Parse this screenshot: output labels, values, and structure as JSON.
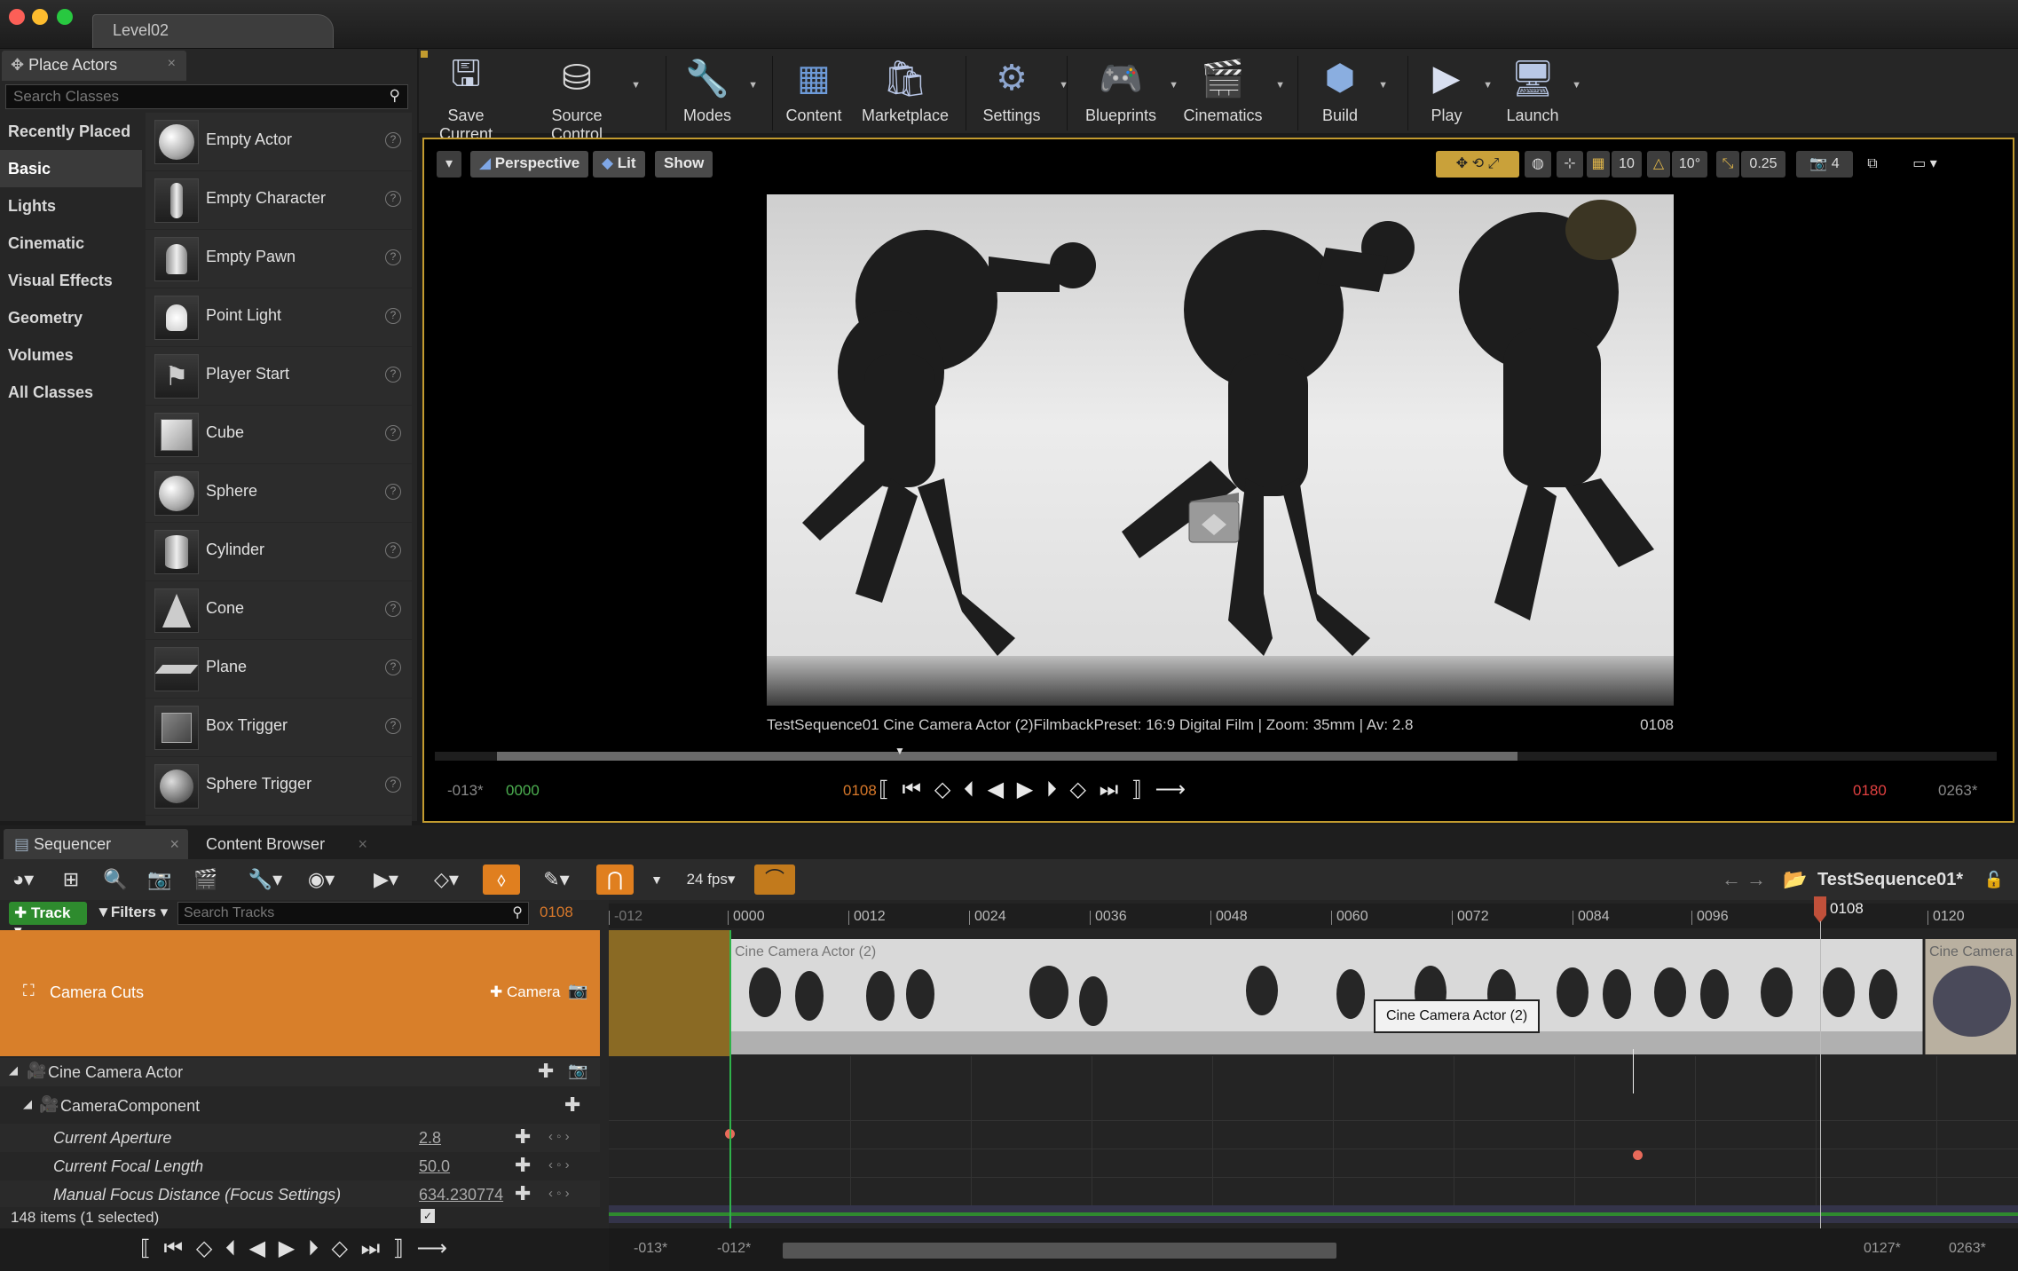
{
  "window": {
    "tab": "Level02"
  },
  "place_actors": {
    "tab_label": "Place Actors",
    "search_placeholder": "Search Classes",
    "categories": [
      "Recently Placed",
      "Basic",
      "Lights",
      "Cinematic",
      "Visual Effects",
      "Geometry",
      "Volumes",
      "All Classes"
    ],
    "active_category": "Basic",
    "items": [
      "Empty Actor",
      "Empty Character",
      "Empty Pawn",
      "Point Light",
      "Player Start",
      "Cube",
      "Sphere",
      "Cylinder",
      "Cone",
      "Plane",
      "Box Trigger",
      "Sphere Trigger"
    ]
  },
  "toolbar": {
    "save": "Save Current",
    "source": "Source Control",
    "modes": "Modes",
    "content": "Content",
    "marketplace": "Marketplace",
    "settings": "Settings",
    "blueprints": "Blueprints",
    "cinematics": "Cinematics",
    "build": "Build",
    "play": "Play",
    "launch": "Launch"
  },
  "viewport": {
    "perspective": "Perspective",
    "lit": "Lit",
    "show": "Show",
    "grid": "10",
    "angle": "10°",
    "scale": "0.25",
    "speed": "4",
    "caption": "TestSequence01  Cine Camera Actor (2)FilmbackPreset: 16:9 Digital Film | Zoom: 35mm | Av: 2.8",
    "frame": "0108",
    "start_out": "-013*",
    "start_in": "0000",
    "current": "0108",
    "end_in": "0180",
    "end_out": "0263*"
  },
  "bottom_tabs": {
    "sequencer": "Sequencer",
    "content_browser": "Content Browser"
  },
  "sequencer": {
    "fps": "24 fps",
    "sequence_name": "TestSequence01*",
    "track_btn": "Track",
    "filters": "Filters",
    "search_placeholder": "Search Tracks",
    "current_frame": "0108",
    "playhead_label": "0108",
    "ruler": [
      "-012",
      "0000",
      "0012",
      "0024",
      "0036",
      "0048",
      "0060",
      "0072",
      "0084",
      "0096",
      "0108",
      "0120"
    ],
    "camera_cuts": "Camera Cuts",
    "add_camera": "Camera",
    "section1": "Cine Camera Actor (2)",
    "section2": "Cine Camera",
    "tooltip": "Cine Camera Actor (2)",
    "actor": "Cine Camera Actor",
    "component": "CameraComponent",
    "props": [
      {
        "name": "Current Aperture",
        "value": "2.8"
      },
      {
        "name": "Current Focal Length",
        "value": "50.0"
      },
      {
        "name": "Manual Focus Distance (Focus Settings)",
        "value": "634.230774"
      }
    ],
    "status": "148 items (1 selected)",
    "view_start_out": "-013*",
    "view_start_in": "-012*",
    "view_end_in": "0127*",
    "view_end_out": "0263*"
  },
  "colors": {
    "accent": "#c29b2f",
    "orange": "#d87f2a",
    "key": "#e86a5a",
    "green": "#2e8b2e"
  }
}
